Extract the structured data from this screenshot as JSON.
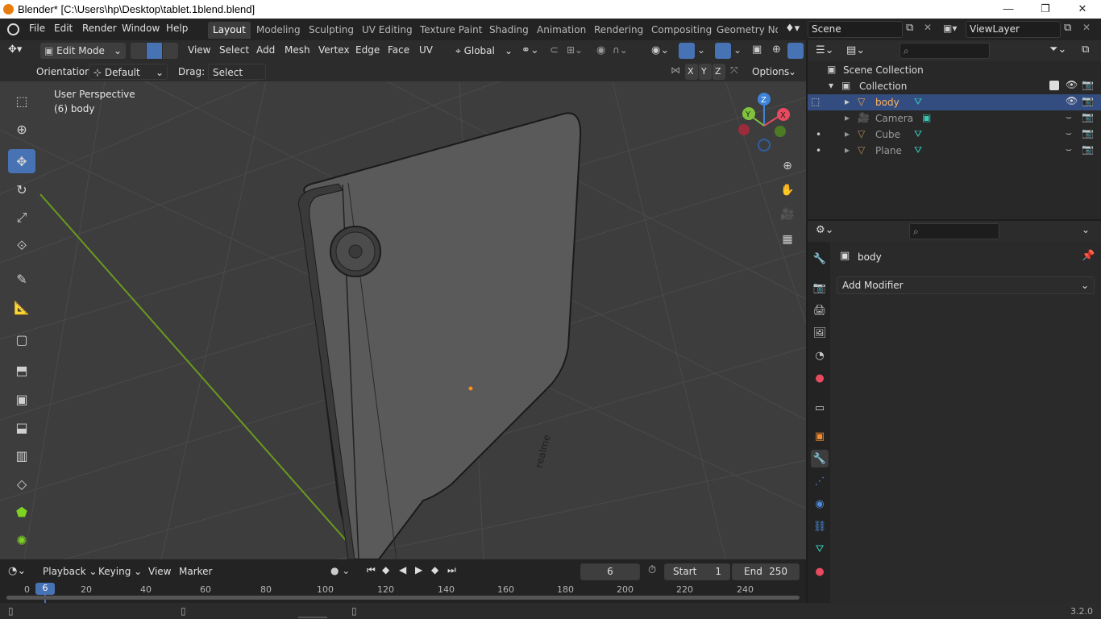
{
  "window": {
    "title": "Blender* [C:\\Users\\hp\\Desktop\\tablet.1blend.blend]",
    "min": "—",
    "max": "❐",
    "close": "✕"
  },
  "menus": [
    "File",
    "Edit",
    "Render",
    "Window",
    "Help"
  ],
  "workspaces": [
    "Layout",
    "Modeling",
    "Sculpting",
    "UV Editing",
    "Texture Paint",
    "Shading",
    "Animation",
    "Rendering",
    "Compositing",
    "Geometry Noc"
  ],
  "scene": {
    "label": "Scene"
  },
  "viewlayer": {
    "label": "ViewLayer"
  },
  "viewport_header": {
    "mode": "Edit Mode",
    "menus": [
      "View",
      "Select",
      "Add",
      "Mesh",
      "Vertex",
      "Edge",
      "Face",
      "UV"
    ],
    "transform": "Global"
  },
  "tool_settings": {
    "orientation_label": "Orientation:",
    "orientation_value": "Default",
    "drag_label": "Drag:",
    "drag_value": "Select Box",
    "axes": [
      "X",
      "Y",
      "Z"
    ],
    "options": "Options"
  },
  "viewport": {
    "perspective": "User Perspective",
    "object": "(6) body",
    "brand_text": "realme",
    "gizmo": {
      "z": "Z",
      "y": "Y",
      "x": "X"
    }
  },
  "timeline": {
    "menus": [
      "Playback",
      "Keying",
      "View",
      "Marker"
    ],
    "current_frame": "6",
    "start_label": "Start",
    "start": "1",
    "end_label": "End",
    "end": "250",
    "ticks": [
      "0",
      "20",
      "40",
      "60",
      "80",
      "100",
      "120",
      "140",
      "160",
      "180",
      "200",
      "220",
      "240"
    ],
    "marker": "6"
  },
  "outliner": {
    "scene_collection": "Scene Collection",
    "collection": "Collection",
    "objects": [
      {
        "name": "body",
        "selected": true
      },
      {
        "name": "Camera",
        "selected": false
      },
      {
        "name": "Cube",
        "selected": false
      },
      {
        "name": "Plane",
        "selected": false
      }
    ]
  },
  "properties": {
    "object_name": "body",
    "add_modifier": "Add Modifier"
  },
  "statusbar": {
    "version": "3.2.0"
  },
  "colors": {
    "accent": "#4772b3",
    "selected_row": "#334d80",
    "viewport_bg": "#3d3d3d",
    "y_axis": "#6a9a1f",
    "x_axis_gizmo": "#e84a5f",
    "y_axis_gizmo": "#80c43c",
    "z_axis_gizmo": "#3d83d8"
  }
}
